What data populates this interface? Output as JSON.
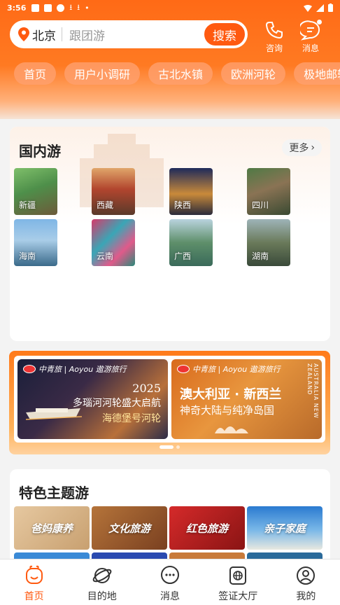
{
  "status_bar": {
    "time": "3:56"
  },
  "search": {
    "city": "北京",
    "placeholder": "跟团游",
    "button": "搜索"
  },
  "top_actions": [
    {
      "label": "咨询",
      "icon": "phone-icon"
    },
    {
      "label": "消息",
      "icon": "message-icon"
    }
  ],
  "chips": [
    "首页",
    "用户小调研",
    "古北水镇",
    "欧洲河轮",
    "极地邮轮"
  ],
  "domestic": {
    "title": "国内游",
    "more": "更多",
    "destinations": [
      "新疆",
      "西藏",
      "陕西",
      "四川",
      "海南",
      "云南",
      "广西",
      "湖南"
    ]
  },
  "banners": [
    {
      "brand": "中青旅 | Aoyou 遨游旅行",
      "year": "2025",
      "line1": "多瑙河河轮盛大启航",
      "line2": "海德堡号河轮"
    },
    {
      "brand": "中青旅 | Aoyou 遨游旅行",
      "line1": "澳大利亚 · 新西兰",
      "line2": "神奇大陆与纯净岛国",
      "vertical": "AUSTRALIA NEW ZEALAND"
    }
  ],
  "themes": {
    "title": "特色主题游",
    "items": [
      "爸妈康养",
      "文化旅游",
      "红色旅游",
      "亲子家庭"
    ]
  },
  "tabbar": [
    {
      "label": "首页",
      "icon": "home-face-icon",
      "active": true
    },
    {
      "label": "目的地",
      "icon": "planet-icon",
      "active": false
    },
    {
      "label": "消息",
      "icon": "chat-bubble-icon",
      "active": false
    },
    {
      "label": "签证大厅",
      "icon": "visa-globe-icon",
      "active": false
    },
    {
      "label": "我的",
      "icon": "profile-icon",
      "active": false
    }
  ],
  "colors": {
    "brand": "#ff5a10",
    "header": "#ff6a16"
  }
}
